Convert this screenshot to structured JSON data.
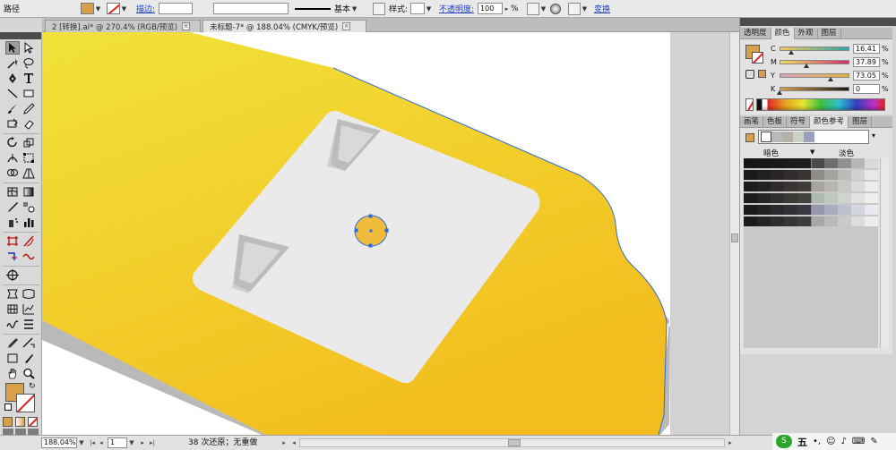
{
  "control_bar": {
    "object_type": "路径",
    "stroke_link": "描边:",
    "stroke_profile": "基本",
    "style_label": "样式:",
    "opacity_link": "不透明度:",
    "opacity_value": "100",
    "opacity_unit": "%",
    "transform_link": "变换"
  },
  "tabs": [
    {
      "label": "2 [转换].ai* @ 270.4% (RGB/预览)",
      "close": "×",
      "active": false
    },
    {
      "label": "未标题-7* @ 188.04% (CMYK/预览)",
      "close": "×",
      "active": true
    }
  ],
  "color_panel": {
    "tabs": [
      "透明度",
      "颜色",
      "外观",
      "图层"
    ],
    "active_tab": "颜色",
    "channels": [
      {
        "label": "C",
        "value": "16.41",
        "unit": "%",
        "level": 0.164
      },
      {
        "label": "M",
        "value": "37.89",
        "unit": "%",
        "level": 0.379
      },
      {
        "label": "Y",
        "value": "73.05",
        "unit": "%",
        "level": 0.7305
      },
      {
        "label": "K",
        "value": "0",
        "unit": "%",
        "level": 0.0
      }
    ],
    "fill_color": "#d9a04c"
  },
  "guide_panel": {
    "tabs": [
      "画笔",
      "色板",
      "符号",
      "颜色参考",
      "图层"
    ],
    "active_tab": "颜色参考",
    "dark_label": "暗色",
    "light_label": "淡色",
    "dropdown_arrow": "▾",
    "harmony_colors": [
      "#ffffff",
      "#b9b9b9",
      "#b7b0a8",
      "#c8d3c2",
      "#9aa0bf"
    ]
  },
  "status_bar": {
    "zoom": "188.04%",
    "artboard": "1",
    "undo_status": "38 次还原；无重做"
  },
  "ime": {
    "label": "五"
  },
  "colors": {
    "yellow_light": "#f1e23a",
    "yellow_dark": "#f3bd1f",
    "plate": "#eaeaea",
    "selection": "#2f6bd8"
  }
}
